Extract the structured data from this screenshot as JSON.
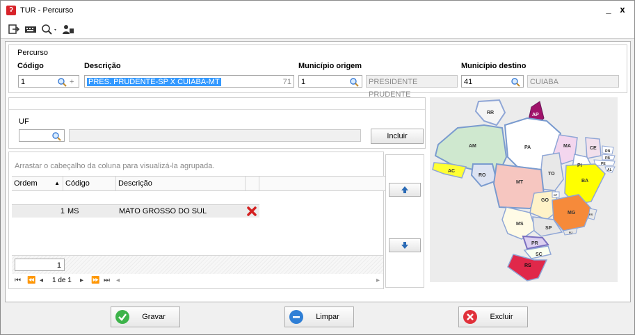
{
  "window": {
    "title": "TUR - Percurso",
    "minimize": "_",
    "close": "x"
  },
  "toolbar": {
    "icons": [
      "exit-icon",
      "keyboard-icon",
      "search-dropdown-icon",
      "users-icon"
    ]
  },
  "percurso": {
    "section_title": "Percurso",
    "codigo": {
      "label": "Código",
      "value": "1"
    },
    "descricao": {
      "label": "Descrição",
      "value": "PRES. PRUDENTE-SP X CUIABA-MT",
      "counter": "71"
    },
    "municipio_origem": {
      "label": "Município origem",
      "code": "1",
      "name": "PRESIDENTE PRUDENTE"
    },
    "municipio_destino": {
      "label": "Município destino",
      "code": "41",
      "name": "CUIABA"
    }
  },
  "uf": {
    "label": "UF",
    "value": "",
    "description": "",
    "incluir": "Incluir"
  },
  "grid": {
    "group_hint": "Arrastar o cabeçalho da coluna para visualizá-la agrupada.",
    "columns": [
      "Ordem",
      "Código",
      "Descrição"
    ],
    "rows": [
      {
        "ordem": "1",
        "codigo": "MS",
        "descricao": "MATO GROSSO DO SUL"
      }
    ],
    "footer_count": "1",
    "pager": "1 de 1"
  },
  "map": {
    "states": [
      "RR",
      "AP",
      "AM",
      "PA",
      "MA",
      "CE",
      "RN",
      "PB",
      "PE",
      "AL",
      "PI",
      "AC",
      "RO",
      "TO",
      "BA",
      "MT",
      "GO",
      "DF",
      "MG",
      "ES",
      "MS",
      "SP",
      "RJ",
      "PR",
      "SC",
      "RS"
    ],
    "highlight": "#e0284a"
  },
  "actions": {
    "gravar": "Gravar",
    "limpar": "Limpar",
    "excluir": "Excluir"
  }
}
